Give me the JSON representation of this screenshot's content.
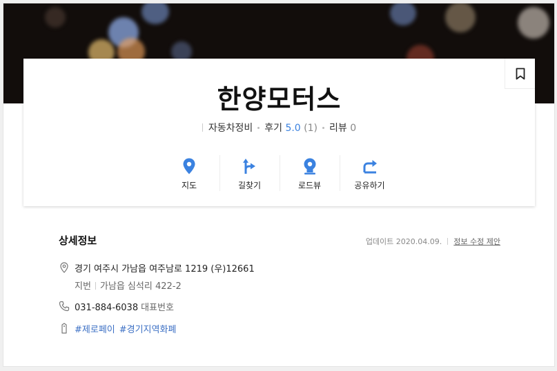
{
  "place": {
    "name": "한양모터스",
    "category": "자동차정비",
    "review_label": "후기",
    "rating": "5.0",
    "review_count": "(1)",
    "blog_label": "리뷰",
    "blog_count": "0"
  },
  "actions": [
    {
      "label": "지도",
      "icon": "map-pin-icon"
    },
    {
      "label": "길찾기",
      "icon": "directions-icon"
    },
    {
      "label": "로드뷰",
      "icon": "roadview-icon"
    },
    {
      "label": "공유하기",
      "icon": "share-icon"
    }
  ],
  "detail": {
    "title": "상세정보",
    "updated": "업데이트 2020.04.09.",
    "edit_link": "정보 수정 제안",
    "address": "경기 여주시 가남읍 여주남로 1219 (우)12661",
    "lot_label": "지번",
    "lot_address": "가남읍 심석리 422-2",
    "phone": "031-884-6038",
    "phone_type": "대표번호",
    "tags": [
      "#제로페이",
      "#경기지역화폐"
    ]
  },
  "colors": {
    "accent": "#3b82e0",
    "cover_bg": "#120d0b"
  }
}
